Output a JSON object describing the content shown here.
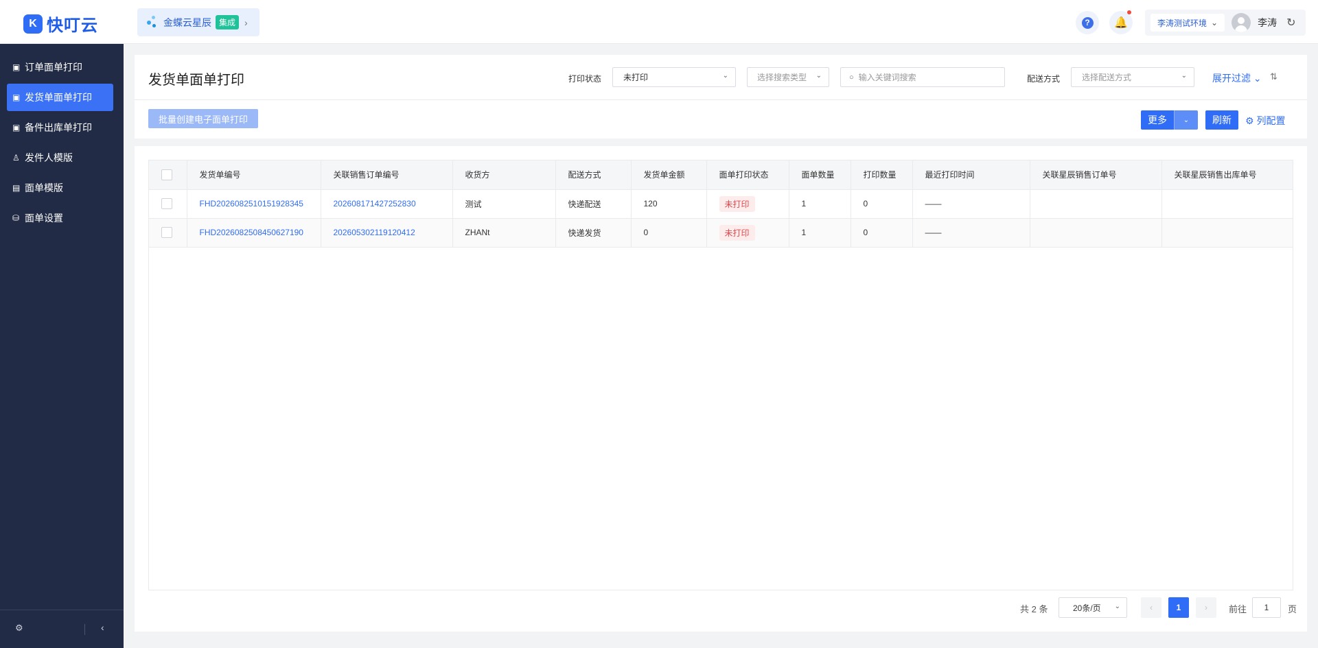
{
  "brand": {
    "logo_mark": "K",
    "name": "快叮云"
  },
  "app_chip": {
    "label": "金蝶云星辰",
    "badge": "集成",
    "chevron": "›"
  },
  "top_right": {
    "help_glyph": "?",
    "bell_glyph": "🔔",
    "environment": "李涛测试环境",
    "user_name": "李涛",
    "refresh_glyph": "↻"
  },
  "sidebar": {
    "items": [
      {
        "label": "订单面单打印",
        "icon": "printer-icon",
        "glyph": "▣"
      },
      {
        "label": "发货单面单打印",
        "icon": "printer-icon",
        "glyph": "▣"
      },
      {
        "label": "备件出库单打印",
        "icon": "printer-icon",
        "glyph": "▣"
      },
      {
        "label": "发件人模版",
        "icon": "user-icon",
        "glyph": "♙"
      },
      {
        "label": "面单模版",
        "icon": "document-icon",
        "glyph": "▤"
      },
      {
        "label": "面单设置",
        "icon": "settings-icon",
        "glyph": "⛁"
      }
    ],
    "active_index": 1,
    "footer": {
      "gear_glyph": "⚙",
      "collapse_glyph": "‹"
    }
  },
  "header": {
    "title": "发货单面单打印",
    "print_status_label": "打印状态",
    "print_status_value": "未打印",
    "search_type_placeholder": "选择搜索类型",
    "keyword_placeholder": "输入关键词搜索",
    "delivery_label": "配送方式",
    "delivery_placeholder": "选择配送方式",
    "expand_filter": "展开过滤",
    "batch_button": "批量创建电子面单打印",
    "more_button": "更多",
    "refresh_button": "刷新",
    "column_config": "列配置"
  },
  "table": {
    "columns": [
      "发货单编号",
      "关联销售订单编号",
      "收货方",
      "配送方式",
      "发货单金额",
      "面单打印状态",
      "面单数量",
      "打印数量",
      "最近打印时间",
      "关联星辰销售订单号",
      "关联星辰销售出库单号"
    ],
    "rows": [
      {
        "id": "FHD2026082510151928345",
        "sales_order": "202608171427252830",
        "receiver": "测试",
        "delivery": "快递配送",
        "amount": "120",
        "status": "未打印",
        "label_qty": "1",
        "print_qty": "0",
        "last_print": "——",
        "xc_order": "",
        "xc_outbound": ""
      },
      {
        "id": "FHD2026082508450627190",
        "sales_order": "202605302119120412",
        "receiver": "ZHANt",
        "delivery": "快递发货",
        "amount": "0",
        "status": "未打印",
        "label_qty": "1",
        "print_qty": "0",
        "last_print": "——",
        "xc_order": "",
        "xc_outbound": ""
      }
    ]
  },
  "pagination": {
    "total_text": "共 2 条",
    "page_size": "20条/页",
    "current_page": "1",
    "goto_label": "前往",
    "goto_value": "1",
    "page_unit": "页",
    "prev_glyph": "‹",
    "next_glyph": "›"
  },
  "colors": {
    "primary": "#2f6df6",
    "sidebar_bg": "#222b45",
    "danger": "#e5484d"
  }
}
